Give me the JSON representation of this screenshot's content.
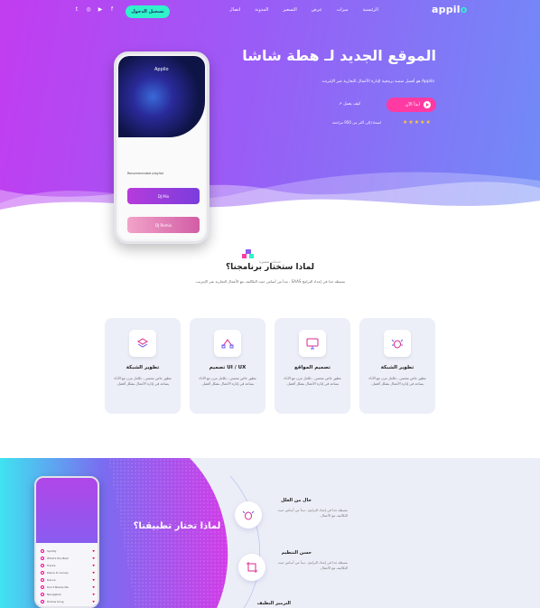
{
  "header": {
    "logo_main": "appil",
    "logo_accent": "o",
    "cta_button": "تسجيل الدخول",
    "menu": [
      "الرئيسية",
      "ميزات",
      "عرض",
      "التسعير",
      "المدونة",
      "اتصال"
    ],
    "social_icons": [
      "twitter-icon",
      "instagram-icon",
      "youtube-icon",
      "facebook-icon"
    ]
  },
  "hero": {
    "title": "الموقع الجديد لـ هطة شاشا",
    "description": "Appilo هو أفضل منصة برمجية لإدارة الأعمال التجارية عبر الإنترنت",
    "primary_button": "ابدأ الآن",
    "video_link": "كيف يعمل",
    "stars": "★★★★★",
    "rating_text": "استنادا إلى أكثر من 950 مراجعة"
  },
  "phone_mock": {
    "app_title": "Appilo",
    "list_header": "Recommended playlist",
    "card1": "DJ Mix",
    "card2": "DJ Remix"
  },
  "why": {
    "small_label": "خدمات متميزة",
    "title": "لماذا ستختار برنامجنا؟",
    "description": "بسيطة جدا في إعداد البرامج SAAS ، تبدأ من أساس حيث التكاليف مع الأعمال التجارية عبر الإنترنت."
  },
  "features": [
    {
      "icon": "bug-icon",
      "title": "تطوير الشبكة",
      "desc": "مطور خاص محسن ، تكامل مرن مع الأداء يساعد في إدارة الأعمال بشكل أفضل."
    },
    {
      "icon": "monitor-icon",
      "title": "تصميم المواقع",
      "desc": "مطور خاص محسن ، تكامل مرن مع الأداء يساعد في إدارة الأعمال بشكل أفضل."
    },
    {
      "icon": "vector-icon",
      "title": "UI / UX تصميم",
      "desc": "مطور خاص محسن ، تكامل مرن مع الأداء يساعد في إدارة الأعمال بشكل أفضل."
    },
    {
      "icon": "layers-icon",
      "title": "تطوير الشبكة",
      "desc": "مطور خاص محسن ، تكامل مرن مع الأداء يساعد في إدارة الأعمال بشكل أفضل."
    }
  ],
  "app_section": {
    "title": "لماذا تختار تطبيقنا؟",
    "items": [
      {
        "icon": "bug-icon",
        "title": "خال من العلل",
        "desc": "بسيطة جدا في إعداد البرامج ، تبدأ من أساس حيث التكاليف مع الأعمال."
      },
      {
        "icon": "crop-icon",
        "title": "حسن التنظيم",
        "desc": "بسيطة جدا في إعداد البرامج ، تبدأ من أساس حيث التكاليف مع الأعمال."
      },
      {
        "icon": "code-icon",
        "title": "الترميز النظيف",
        "desc": ""
      }
    ],
    "phone_tracks": [
      "Spotify",
      "What's the Best",
      "Tracks",
      "Peace to Lonely",
      "Dance",
      "Don't Blame Me",
      "Navigation",
      "Hollow Song"
    ]
  },
  "colors": {
    "hero_start": "#c23cf0",
    "hero_end": "#6f8cf7",
    "accent_pink": "#ff3aa2",
    "accent_teal": "#2ff3c9"
  }
}
